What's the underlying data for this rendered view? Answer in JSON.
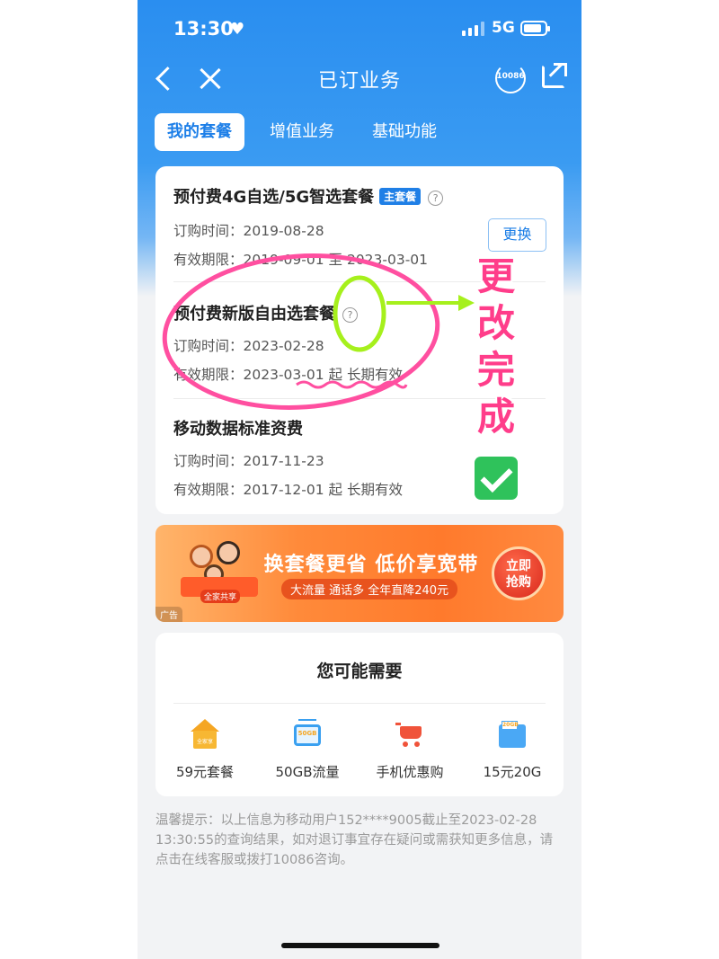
{
  "status_bar": {
    "time": "13:30",
    "network": "5G",
    "battery_level": 0.85
  },
  "nav": {
    "title": "已订业务",
    "service_label": "10086"
  },
  "tabs": [
    {
      "label": "我的套餐",
      "active": true
    },
    {
      "label": "增值业务",
      "active": false
    },
    {
      "label": "基础功能",
      "active": false
    }
  ],
  "packages": [
    {
      "name": "预付费4G自选/5G智选套餐",
      "badge": "主套餐",
      "order_label": "订购时间：",
      "order_date": "2019-08-28",
      "valid_label": "有效期限：",
      "valid_range": "2019-09-01 至 2023-03-01",
      "action": "更换"
    },
    {
      "name": "预付费新版自由选套餐",
      "order_label": "订购时间：",
      "order_date": "2023-02-28",
      "valid_label": "有效期限：",
      "valid_range": "2023-03-01 起 长期有效"
    },
    {
      "name": "移动数据标准资费",
      "order_label": "订购时间：",
      "order_date": "2017-11-23",
      "valid_label": "有效期限：",
      "valid_range": "2017-12-01 起 长期有效"
    }
  ],
  "ad": {
    "title": "换套餐更省 低价享宽带",
    "subtitle": "大流量 通话多 全年直降240元",
    "cta_line1": "立即",
    "cta_line2": "抢购",
    "family_tag": "全家共享",
    "tag": "广告"
  },
  "recommend": {
    "title": "您可能需要",
    "items": [
      {
        "label": "59元套餐",
        "icon": "house-icon",
        "icon_text": "全家享"
      },
      {
        "label": "50GB流量",
        "icon": "tv-data-icon",
        "icon_text": "50GB"
      },
      {
        "label": "手机优惠购",
        "icon": "cart-icon"
      },
      {
        "label": "15元20G",
        "icon": "data-card-icon",
        "icon_text": "20GB"
      }
    ]
  },
  "tip": "温馨提示：以上信息为移动用户152****9005截止至2023-02-28 13:30:55的查询结果，如对退订事宜存在疑问或需获知更多信息，请点击在线客服或拨打10086咨询。",
  "annotation": {
    "text": "更改完成",
    "check": "check-mark-icon"
  },
  "colors": {
    "primary": "#1f7fe6",
    "annotation_pink": "#ff3d8a",
    "annotation_green": "#a6f01c"
  }
}
